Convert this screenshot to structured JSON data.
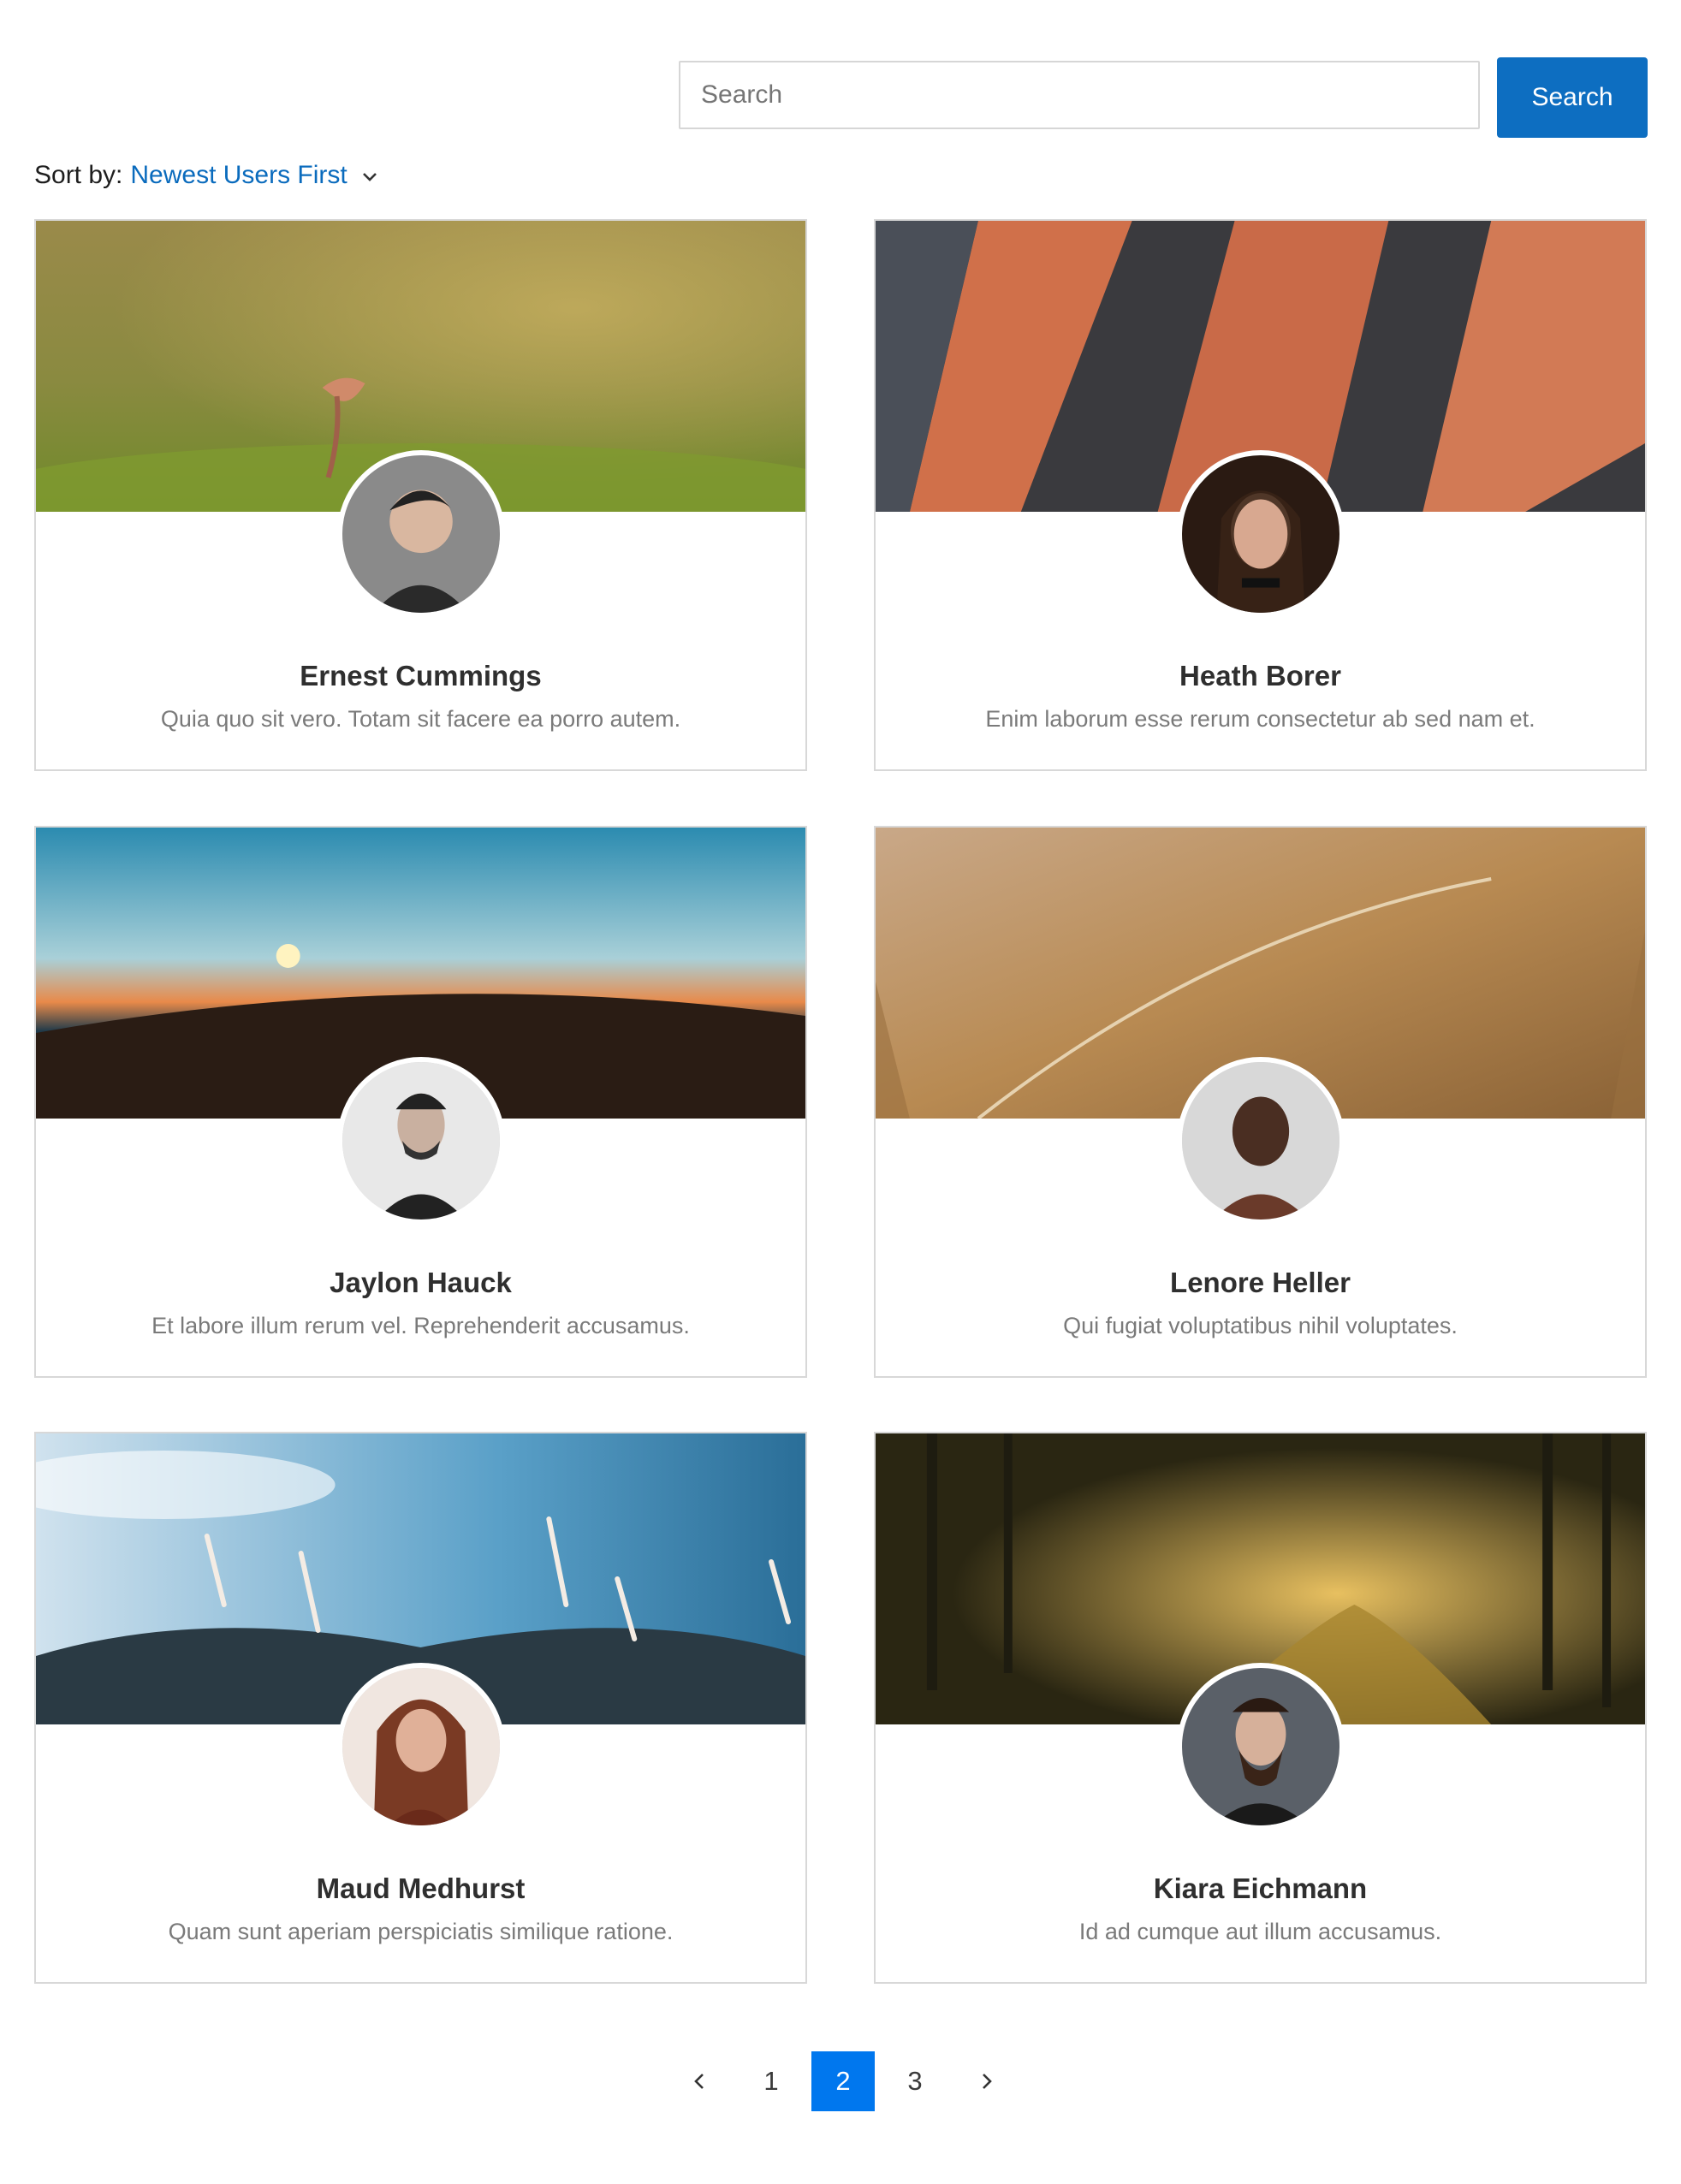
{
  "search": {
    "placeholder": "Search",
    "button_label": "Search"
  },
  "sort": {
    "label": "Sort by:",
    "value": "Newest Users First"
  },
  "users": [
    {
      "name": "Ernest Cummings",
      "description": "Quia quo sit vero. Totam sit facere ea porro autem."
    },
    {
      "name": "Heath Borer",
      "description": "Enim laborum esse rerum consectetur ab sed nam et."
    },
    {
      "name": "Jaylon Hauck",
      "description": "Et labore illum rerum vel. Reprehenderit accusamus."
    },
    {
      "name": "Lenore Heller",
      "description": "Qui fugiat voluptatibus nihil voluptates."
    },
    {
      "name": "Maud Medhurst",
      "description": "Quam sunt aperiam perspiciatis similique ratione."
    },
    {
      "name": "Kiara Eichmann",
      "description": "Id ad cumque aut illum accusamus."
    }
  ],
  "pagination": {
    "prev_icon": "chevron-left-icon",
    "next_icon": "chevron-right-icon",
    "pages": [
      "1",
      "2",
      "3"
    ],
    "current": "2"
  },
  "colors": {
    "accent": "#0d6ec1",
    "link": "#0a6bbd",
    "active_page": "#0077ee"
  }
}
